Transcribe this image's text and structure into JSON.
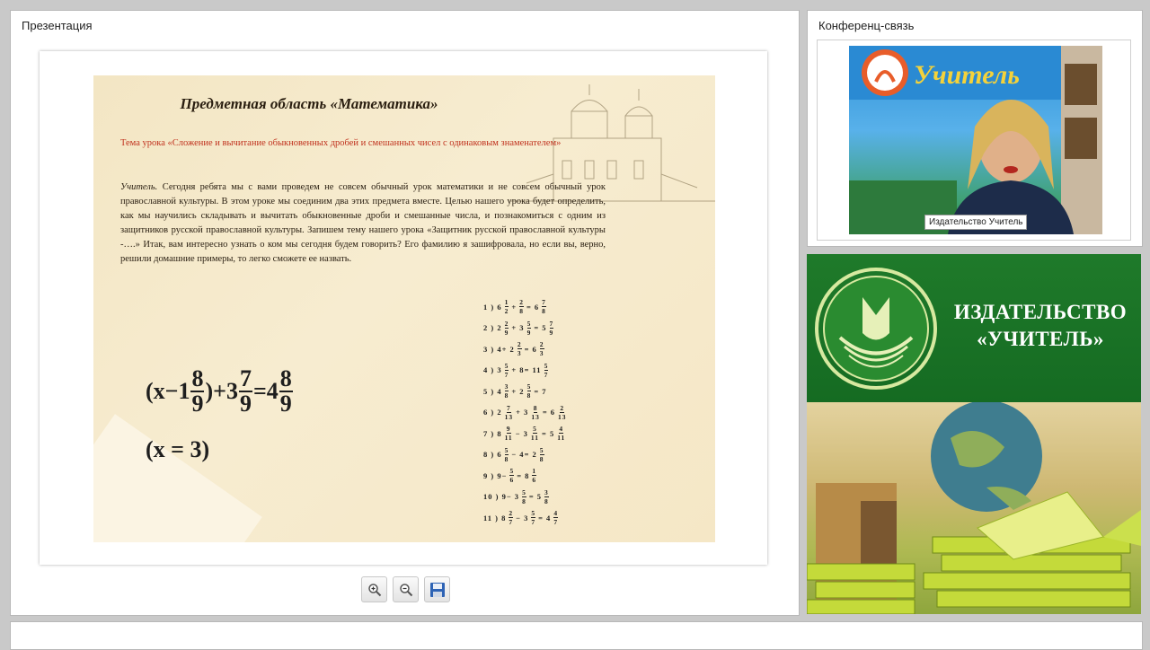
{
  "presentation": {
    "panel_title": "Презентация",
    "slide": {
      "title": "Предметная область «Математика»",
      "topic": "Тема урока «Сложение и вычитание обыкновенных дробей и смешанных чисел с одинаковым знаменателем»",
      "teacher_label": "Учитель.",
      "teacher_text": " Сегодня ребята мы с вами проведем не совсем обычный урок математики и не совсем обычный урок православной культуры. В этом уроке мы соединим два этих предмета вместе. Целью нашего урока  будет определить, как мы научились складывать и вычитать обыкновенные дроби и смешанные числа, и  познакомиться с одним из защитников русской православной культуры. Запишем тему нашего  урока «Защитник  русской православной культуры -….» Итак, вам интересно узнать о ком мы сегодня будем говорить?  Его фамилию я зашифровала, но если вы, верно, решили домашние примеры, то легко сможете ее назвать.",
      "equation": {
        "open": "(x−1",
        "f1n": "8",
        "f1d": "9",
        "mid": ")+3",
        "f2n": "7",
        "f2d": "9",
        "eq": "=4",
        "f3n": "8",
        "f3d": "9"
      },
      "answer": "(x = 3)",
      "examples": [
        {
          "num": "1 ) 6",
          "a": [
            "1",
            "2"
          ],
          "op": "+",
          "b": [
            "2",
            "8"
          ],
          "res": "=  6",
          "c": [
            "7",
            "8"
          ]
        },
        {
          "num": "2 ) 2",
          "a": [
            "2",
            "9"
          ],
          "op": "+  3",
          "b": [
            "5",
            "9"
          ],
          "res": "=  5",
          "c": [
            "7",
            "9"
          ]
        },
        {
          "num": "3 ) 4",
          "a": [
            "",
            ""
          ],
          "op": "+  2",
          "b": [
            "2",
            "3"
          ],
          "res": "=  6",
          "c": [
            "2",
            "3"
          ]
        },
        {
          "num": "4 ) 3",
          "a": [
            "5",
            "7"
          ],
          "op": "+  8",
          "b": [
            "",
            ""
          ],
          "res": "=  11",
          "c": [
            "5",
            "7"
          ]
        },
        {
          "num": "5 ) 4",
          "a": [
            "3",
            "8"
          ],
          "op": "+  2",
          "b": [
            "5",
            "8"
          ],
          "res": "=  7",
          "c": [
            "",
            ""
          ]
        },
        {
          "num": "6 ) 2",
          "a": [
            "7",
            "13"
          ],
          "op": "+  3",
          "b": [
            "8",
            "13"
          ],
          "res": "=  6",
          "c": [
            "2",
            "13"
          ]
        },
        {
          "num": "7 ) 8",
          "a": [
            "9",
            "11"
          ],
          "op": "−  3",
          "b": [
            "5",
            "11"
          ],
          "res": "=  5",
          "c": [
            "4",
            "11"
          ]
        },
        {
          "num": "8 ) 6",
          "a": [
            "5",
            "8"
          ],
          "op": "−  4",
          "b": [
            "",
            ""
          ],
          "res": "=  2",
          "c": [
            "5",
            "8"
          ]
        },
        {
          "num": "9 ) 9",
          "a": [
            "",
            ""
          ],
          "op": "−",
          "b": [
            "5",
            "6"
          ],
          "res": "=  8",
          "c": [
            "1",
            "6"
          ]
        },
        {
          "num": "10 ) 9",
          "a": [
            "",
            ""
          ],
          "op": "−  3",
          "b": [
            "5",
            "8"
          ],
          "res": "=  5",
          "c": [
            "3",
            "8"
          ]
        },
        {
          "num": "11 ) 8",
          "a": [
            "2",
            "7"
          ],
          "op": "−  3",
          "b": [
            "5",
            "7"
          ],
          "res": "=  4",
          "c": [
            "4",
            "7"
          ]
        }
      ]
    },
    "toolbar": {
      "zoom_in_icon": "zoom-in-icon",
      "zoom_out_icon": "zoom-out-icon",
      "save_icon": "save-icon"
    }
  },
  "conference": {
    "panel_title": "Конференц-связь",
    "video_caption": "Издательство Учитель",
    "backdrop_text": "Учитель"
  },
  "publisher": {
    "name_line1": "ИЗДАТЕЛЬСТВО",
    "name_line2": "«УЧИТЕЛЬ»"
  }
}
